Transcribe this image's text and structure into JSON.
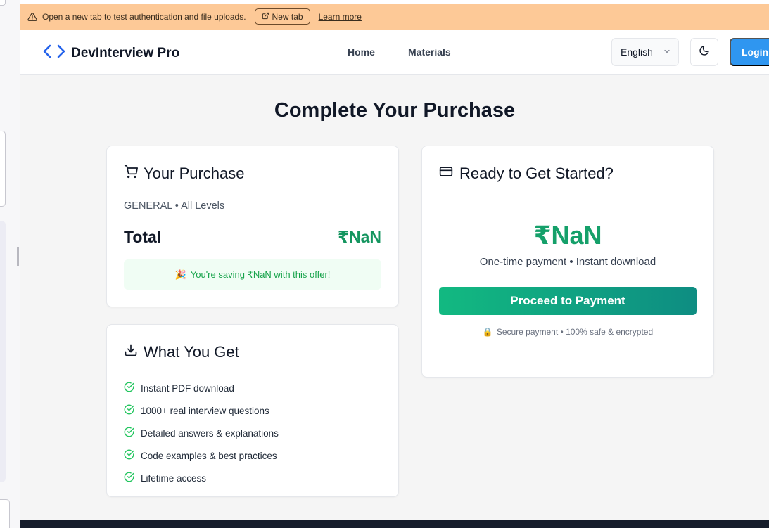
{
  "notice": {
    "message": "Open a new tab to test authentication and file uploads.",
    "new_tab_label": "New tab",
    "learn_more_label": "Learn more",
    "background_color": "#fdc997"
  },
  "header": {
    "brand_title": "DevInterview Pro",
    "nav": {
      "home": "Home",
      "materials": "Materials"
    },
    "language": "English",
    "login_label": "Login"
  },
  "page_title": "Complete Your Purchase",
  "purchase": {
    "heading": "Your Purchase",
    "meta": "GENERAL • All Levels",
    "total_label": "Total",
    "total_value": "₹NaN",
    "saving_emoji": "🎉",
    "saving_text": "You're saving ₹NaN with this offer!"
  },
  "what_you_get": {
    "heading": "What You Get",
    "items": [
      "Instant PDF download",
      "1000+ real interview questions",
      "Detailed answers & explanations",
      "Code examples & best practices",
      "Lifetime access"
    ]
  },
  "ready": {
    "heading": "Ready to Get Started?",
    "price": "₹NaN",
    "price_sub": "One-time payment • Instant download",
    "pay_button": "Proceed to Payment",
    "secure_emoji": "🔒",
    "secure_text": "Secure payment • 100% safe & encrypted"
  },
  "colors": {
    "accent_blue": "#2f96f0",
    "price_green": "#15a06a",
    "button_gradient_start": "#12b981",
    "button_gradient_end": "#0e8d82"
  }
}
